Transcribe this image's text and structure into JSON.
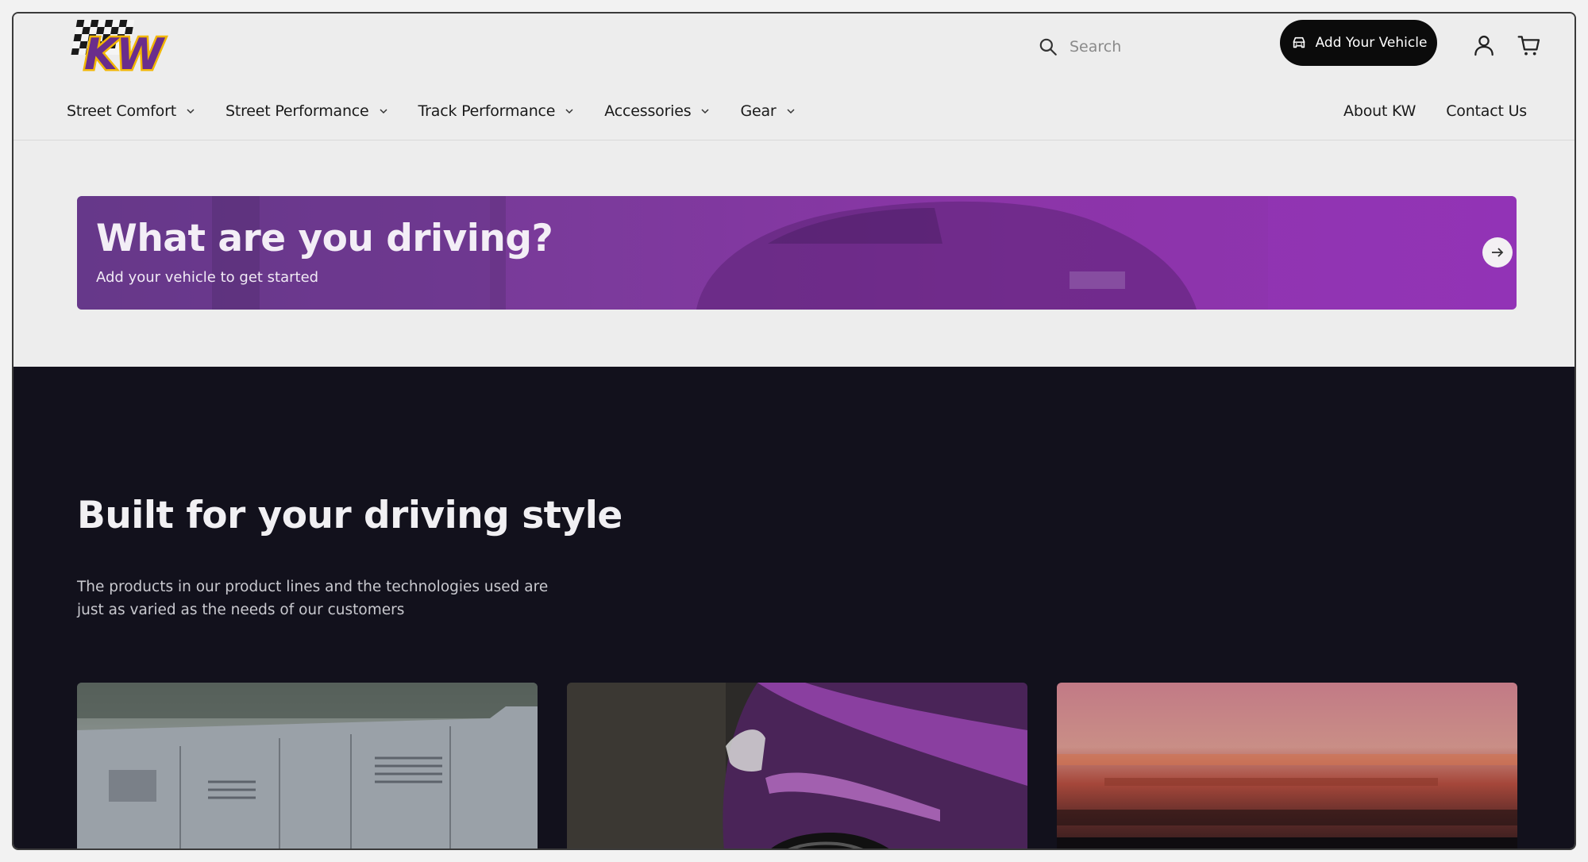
{
  "header": {
    "logo_text": "KW",
    "search": {
      "placeholder": "Search"
    },
    "add_vehicle_label": "Add Your Vehicle"
  },
  "nav": {
    "items": [
      {
        "label": "Street Comfort"
      },
      {
        "label": "Street Performance"
      },
      {
        "label": "Track Performance"
      },
      {
        "label": "Accessories"
      },
      {
        "label": "Gear"
      }
    ],
    "right": [
      {
        "label": "About KW"
      },
      {
        "label": "Contact Us"
      }
    ]
  },
  "banner": {
    "title": "What are you driving?",
    "subtitle": "Add your vehicle to get started"
  },
  "section": {
    "title": "Built for your driving style",
    "description": "The products in our product lines and the technologies used are just as varied as the needs of our customers"
  },
  "colors": {
    "accent_purple": "#7b3a9b",
    "logo_yellow": "#f2b705",
    "dark_bg": "#12111c",
    "button_black": "#0b0b0b"
  },
  "icons": [
    "search-icon",
    "car-icon",
    "user-icon",
    "cart-icon",
    "chevron-down-icon",
    "arrow-right-icon"
  ]
}
